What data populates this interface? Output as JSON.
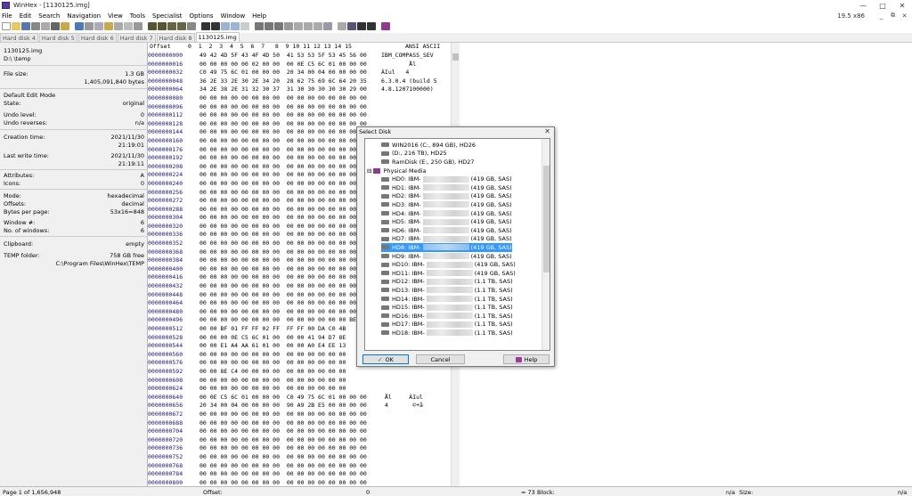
{
  "window": {
    "title": "WinHex - [1130125.img]",
    "version": "19.5 x86"
  },
  "menu": [
    "File",
    "Edit",
    "Search",
    "Navigation",
    "View",
    "Tools",
    "Specialist",
    "Options",
    "Window",
    "Help"
  ],
  "tabs": [
    "Hard disk 4",
    "Hard disk 5",
    "Hard disk 6",
    "Hard disk 7",
    "Hard disk 8",
    "1130125.img"
  ],
  "left_panel": {
    "file_name": "1130125.img",
    "path": "D:\\          \\temp",
    "file_size_label": "File size:",
    "file_size_gb": "1.3 GB",
    "file_size_bytes": "1,405,091,840 bytes",
    "default_edit_mode": "Default Edit Mode",
    "state_label": "State:",
    "state_value": "original",
    "undo_level_label": "Undo level:",
    "undo_level_value": "0",
    "undo_reverses_label": "Undo reverses:",
    "undo_reverses_value": "n/a",
    "creation_time_label": "Creation time:",
    "creation_date": "2021/11/30",
    "creation_time": "21:19:01",
    "last_write_label": "Last write time:",
    "last_write_date": "2021/11/30",
    "last_write_time": "21:19:11",
    "attributes_label": "Attributes:",
    "attributes_value": "A",
    "icons_label": "Icons:",
    "icons_value": "0",
    "mode_label": "Mode:",
    "mode_value": "hexadecimal",
    "offsets_label": "Offsets:",
    "offsets_value": "decimal",
    "bpp_label": "Bytes per page:",
    "bpp_value": "53x16=848",
    "window_num_label": "Window #:",
    "window_num_value": "6",
    "num_windows_label": "No. of windows:",
    "num_windows_value": "6",
    "clipboard_label": "Clipboard:",
    "clipboard_value": "empty",
    "temp_label": "TEMP folder:",
    "temp_free": "758 GB free",
    "temp_path": "C:\\Program Files\\WinHex\\TEMP"
  },
  "hex": {
    "header": "Offset     0  1  2  3  4  5  6  7   8  9 10 11 12 13 14 15",
    "ascii_header": "ANSI ASCII",
    "offsets": [
      "0000000000",
      "0000000016",
      "0000000032",
      "0000000048",
      "0000000064",
      "0000000080",
      "0000000096",
      "0000000112",
      "0000000128",
      "0000000144",
      "0000000160",
      "0000000176",
      "0000000192",
      "0000000208",
      "0000000224",
      "0000000240",
      "0000000256",
      "0000000272",
      "0000000288",
      "0000000304",
      "0000000320",
      "0000000336",
      "0000000352",
      "0000000368",
      "0000000384",
      "0000000400",
      "0000000416",
      "0000000432",
      "0000000448",
      "0000000464",
      "0000000480",
      "0000000496",
      "0000000512",
      "0000000528",
      "0000000544",
      "0000000560",
      "0000000576",
      "0000000592",
      "0000000608",
      "0000000624",
      "0000000640",
      "0000000656",
      "0000000672",
      "0000000688",
      "0000000704",
      "0000000720",
      "0000000736",
      "0000000752",
      "0000000768",
      "0000000784",
      "0000000800",
      "0000000816",
      "0000000832"
    ],
    "rows": [
      "49 42 4D 5F 43 4F 4D 50  41 53 53 5F 53 45 56 00",
      "00 00 00 00 00 02 00 00  00 0E C5 6C 01 00 00 00",
      "C0 49 75 6C 01 00 00 00  20 34 00 04 00 00 00 00",
      "36 2E 33 2E 30 2E 34 20  28 62 75 69 6C 64 20 35",
      "34 2E 38 2E 31 32 30 37  31 30 30 30 30 30 29 00",
      "00 00 00 00 00 00 00 00  00 00 00 00 00 00 00 00",
      "00 00 00 00 00 00 00 00  00 00 00 00 00 00 00 00",
      "00 00 00 00 00 00 00 00  00 00 00 00 00 00 00 00",
      "00 00 00 00 00 00 00 00  00 00 00 00 00 00 00 00",
      "00 00 00 00 00 00 00 00  00 00 00 00 00 00 00 00",
      "00 00 00 00 00 00 00 00  00 00 00 00 00 00 00 00",
      "00 00 00 00 00 00 00 00  00 00 00 00 00 00 00 00",
      "00 00 00 00 00 00 00 00  00 00 00 00 00 00 00 00",
      "00 00 00 00 00 00 00 00  00 00 00 00 00 00 00 00",
      "00 00 00 00 00 00 00 00  00 00 00 00 00 00 00 00",
      "00 00 00 00 00 00 00 00  00 00 00 00 00 00 00 00",
      "00 00 00 00 00 00 00 00  00 00 00 00 00 00 00 00",
      "00 00 00 00 00 00 00 00  00 00 00 00 00 00 00 00",
      "00 00 00 00 00 00 00 00  00 00 00 00 00 00 00 00",
      "00 00 00 00 00 00 00 00  00 00 00 00 00 00 00 00",
      "00 00 00 00 00 00 00 00  00 00 00 00 00 00 00 00",
      "00 00 00 00 00 00 00 00  00 00 00 00 00 00 00 00",
      "00 00 00 00 00 00 00 00  00 00 00 00 00 00 00 00",
      "00 00 00 00 00 00 00 00  00 00 00 00 00 00 00 00",
      "00 00 00 00 00 00 00 00  00 00 00 00 00 00 00 00",
      "00 00 00 00 00 00 00 00  00 00 00 00 00 00 00 00",
      "00 00 00 00 00 00 00 00  00 00 00 00 00 00 00 00",
      "00 00 00 00 00 00 00 00  00 00 00 00 00 00 00 00",
      "00 00 00 00 00 00 00 00  00 00 00 00 00 00 00 00",
      "00 00 00 00 00 00 00 00  00 00 00 00 00 00 00 00",
      "00 00 00 00 00 00 00 00  00 00 00 00 00 00 00 00",
      "00 00 00 00 00 00 00 00  00 00 00 00 00 00 BE 70",
      "00 00 BF 01 FF FF 02 FF  FF FF 00 DA C0 4B",
      "00 00 00 0E C5 6C 01 00  00 00 41 94 D7 8E",
      "00 00 E1 A4 AA 61 01 00  00 00 A0 E4 EE 13",
      "00 00 00 00 00 00 00 00  00 00 00 00 00 00",
      "00 00 00 00 00 00 00 00  00 00 00 00 00 00",
      "00 00 8E C4 00 00 00 00  00 00 00 00 00 00",
      "00 00 00 00 00 00 00 00  00 00 00 00 00 00",
      "00 00 00 00 00 00 00 00  00 00 00 00 00 00",
      "00 0E C5 6C 01 00 00 00  C0 49 75 6C 01 00 00 00",
      "20 34 00 04 00 00 00 00  90 A9 2B E5 00 00 00 00",
      "00 00 00 00 00 00 00 00  00 00 00 00 00 00 00 00",
      "00 00 00 00 00 00 00 00  00 00 00 00 00 00 00 00",
      "00 00 00 00 00 00 00 00  00 00 00 00 00 00 00 00",
      "00 00 00 00 00 00 00 00  00 00 00 00 00 00 00 00",
      "00 00 00 00 00 00 00 00  00 00 00 00 00 00 00 00",
      "00 00 00 00 00 00 00 00  00 00 00 00 00 00 00 00",
      "00 00 00 00 00 00 00 00  00 00 00 00 00 00 00 00",
      "00 00 00 00 00 00 00 00  00 00 00 00 00 00 00 00",
      "00 00 00 00 00 00 00 00  00 00 00 00 00 00 00 00",
      "00 00 00 00 00 00 00 00  00 00 00 00 00 00 00 00",
      "00 00 00 00 00 00 00 00  00 00 00 00 00 00 00 00"
    ],
    "ascii_rows": {
      "0": "IBM_COMPASS_SEV",
      "1": "        Ål",
      "2": "ÀIul   4",
      "3": "6.3.0.4 (build 5",
      "4": "4.8.1207100000)",
      "40": " Ål     ÀIul",
      "41": " 4       ©+å"
    }
  },
  "dialog": {
    "title": "Select Disk",
    "logical": [
      "WIN2016 (C:, 894 GB), HD26",
      "(D:, 216 TB), HD25",
      "RamDisk (E:, 250 GB), HD27"
    ],
    "physical_media_label": "Physical Media",
    "disks": [
      {
        "id": "HD0: IBM-",
        "size": "(419 GB, SAS)"
      },
      {
        "id": "HD1: IBM-",
        "size": "(419 GB, SAS)"
      },
      {
        "id": "HD2: IBM-",
        "size": "(419 GB, SAS)"
      },
      {
        "id": "HD3: IBM-",
        "size": "(419 GB, SAS)"
      },
      {
        "id": "HD4: IBM-",
        "size": "(419 GB, SAS)"
      },
      {
        "id": "HD5: IBM-",
        "size": "(419 GB, SAS)"
      },
      {
        "id": "HD6: IBM-",
        "size": "(419 GB, SAS)"
      },
      {
        "id": "HD7: IBM-",
        "size": "(419 GB, SAS)"
      },
      {
        "id": "HD8: IBM-",
        "size": "(419 GB, SAS)",
        "selected": true
      },
      {
        "id": "HD9: IBM-",
        "size": "(419 GB, SAS)"
      },
      {
        "id": "HD10: IBM-",
        "size": "(419 GB, SAS)"
      },
      {
        "id": "HD11: IBM-",
        "size": "(419 GB, SAS)"
      },
      {
        "id": "HD12: IBM-",
        "size": "(1.1 TB, SAS)"
      },
      {
        "id": "HD13: IBM-",
        "size": "(1.1 TB, SAS)"
      },
      {
        "id": "HD14: IBM-",
        "size": "(1.1 TB, SAS)"
      },
      {
        "id": "HD15: IBM-",
        "size": "(1.1 TB, SAS)"
      },
      {
        "id": "HD16: IBM-",
        "size": "(1.1 TB, SAS)"
      },
      {
        "id": "HD17: IBM-",
        "size": "(1.1 TB, SAS)"
      },
      {
        "id": "HD18: IBM-",
        "size": "(1.1 TB, SAS)"
      }
    ],
    "ok_label": "OK",
    "cancel_label": "Cancel",
    "help_label": "Help"
  },
  "status": {
    "page": "Page 1 of 1,656,948",
    "offset_label": "Offset:",
    "offset_value": "0",
    "eq": "= 73",
    "block_label": "Block:",
    "block_value": "n/a",
    "size_label": "Size:",
    "size_value": "n/a"
  },
  "colors": {
    "accent": "#3399ff",
    "offset_text": "#14147a",
    "panel_bg": "#f0f0f0"
  }
}
